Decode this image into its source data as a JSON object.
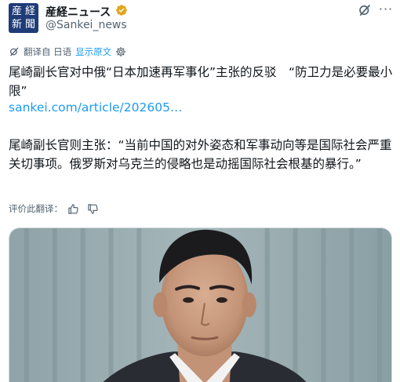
{
  "account": {
    "avatar_glyphs": [
      "産",
      "経",
      "新",
      "聞"
    ],
    "display_name": "産経ニュース",
    "handle": "@Sankei_news",
    "verified_color": "#e2a521",
    "verified_icon": "gold-verified-badge",
    "grok_icon": "grok-icon",
    "more_icon": "more-horizontal-icon",
    "more_label": "···"
  },
  "translation": {
    "label": "翻译自 日语",
    "show_original": "显示原文",
    "icon": "translate-icon",
    "settings_icon": "gear-icon"
  },
  "post": {
    "paragraph_1": "尾崎副长官对中俄“日本加速再军事化”主张的反驳　“防卫力是必要最小限”",
    "link": "sankei.com/article/202605…",
    "paragraph_2": "尾崎副长官则主张：“当前中国的对外姿态和军事动向等是国际社会严重关切事项。俄罗斯对乌克兰的侵略也是动摇国际社会根基的暴行。”"
  },
  "rate_translation": {
    "label": "评价此翻译：",
    "thumbs_up_icon": "thumbs-up-icon",
    "thumbs_down_icon": "thumbs-down-icon"
  },
  "colors": {
    "text_primary": "#0f1419",
    "text_secondary": "#536471",
    "link": "#1d9bf0",
    "avatar_bg": "#1f3c78"
  }
}
